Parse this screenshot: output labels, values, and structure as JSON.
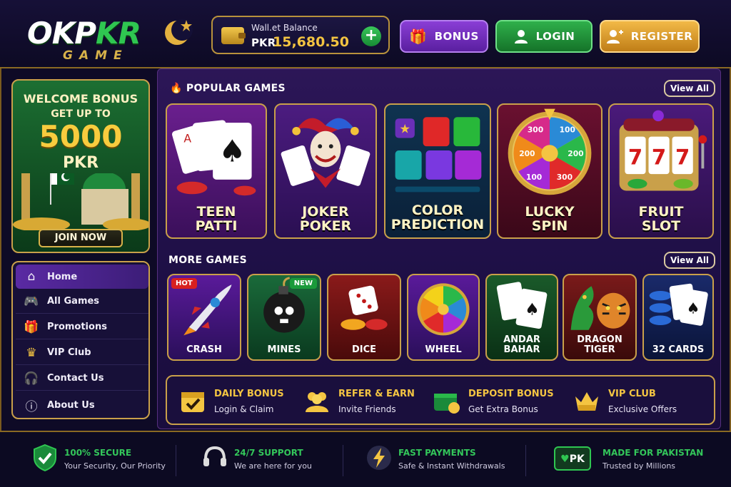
{
  "header": {
    "logo_main_1": "OKP",
    "logo_main_2": "KR",
    "logo_sub": "GAME",
    "wallet": {
      "label": "Wall.et Balance",
      "currency": "PKR",
      "amount": "15,680.50",
      "add_label": "+"
    },
    "buttons": {
      "bonus": "BONUS",
      "login": "LOGIN",
      "register": "REGISTER"
    }
  },
  "promo": {
    "line1": "WELCOME BONUS",
    "line2": "GET UP TO",
    "amount": "5000",
    "currency": "PKR",
    "join_label": "JOIN NOW"
  },
  "sidebar": {
    "items": [
      {
        "label": "Home",
        "icon": "home-icon",
        "glyph": "⌂"
      },
      {
        "label": "All Games",
        "icon": "gamepad-icon",
        "glyph": "🎮"
      },
      {
        "label": "Promotions",
        "icon": "gift-icon",
        "glyph": "🎁"
      },
      {
        "label": "VIP Club",
        "icon": "vip-crown-icon",
        "glyph": "♛"
      },
      {
        "label": "Contact Us",
        "icon": "headset-icon",
        "glyph": "🎧"
      },
      {
        "label": "About Us",
        "icon": "info-icon",
        "glyph": "ⓘ"
      }
    ]
  },
  "popular": {
    "title": "POPULAR GAMES",
    "view_all": "View All",
    "games": [
      {
        "line1": "TEEN",
        "line2": "PATTI"
      },
      {
        "line1": "JOKER",
        "line2": "POKER"
      },
      {
        "line1": "COLOR",
        "line2": "PREDICTION"
      },
      {
        "line1": "LUCKY",
        "line2": "SPIN"
      },
      {
        "line1": "FRUIT",
        "line2": "SLOT"
      }
    ],
    "wheel_values": [
      "100",
      "200",
      "300",
      "100",
      "200",
      "300"
    ],
    "slot_digits": [
      "7",
      "7",
      "7"
    ]
  },
  "more": {
    "title": "MORE GAMES",
    "view_all": "View All",
    "games": [
      {
        "line1": "CRASH",
        "line2": "",
        "tag": "HOT"
      },
      {
        "line1": "MINES",
        "line2": "",
        "tag": "NEW"
      },
      {
        "line1": "DICE",
        "line2": "",
        "tag": ""
      },
      {
        "line1": "WHEEL",
        "line2": "",
        "tag": ""
      },
      {
        "line1": "ANDAR BAHAR",
        "line2": "",
        "tag": ""
      },
      {
        "line1": "DRAGON",
        "line2": "TIGER",
        "tag": ""
      },
      {
        "line1": "32 CARDS",
        "line2": "",
        "tag": ""
      }
    ]
  },
  "features": [
    {
      "title": "DAILY BONUS",
      "subtitle": "Login & Claim",
      "icon": "calendar-check-icon"
    },
    {
      "title": "REFER & EARN",
      "subtitle": "Invite Friends",
      "icon": "users-icon"
    },
    {
      "title": "DEPOSIT BONUS",
      "subtitle": "Get Extra Bonus",
      "icon": "wallet-coin-icon"
    },
    {
      "title": "VIP CLUB",
      "subtitle": "Exclusive Offers",
      "icon": "vip-crown-icon"
    }
  ],
  "footer": [
    {
      "title": "100% SECURE",
      "subtitle": "Your Security, Our Priority",
      "icon": "shield-check-icon"
    },
    {
      "title": "24/7 SUPPORT",
      "subtitle": "We are here for you",
      "icon": "headset-icon"
    },
    {
      "title": "FAST PAYMENTS",
      "subtitle": "Safe & Instant Withdrawals",
      "icon": "lightning-icon"
    },
    {
      "title": "MADE FOR PAKISTAN",
      "subtitle": "Trusted by Millions",
      "icon": "pk-badge-icon",
      "badge": "PK"
    }
  ],
  "colors": {
    "gold": "#c9a04a",
    "green": "#2fc651",
    "purple": "#5a2aa3",
    "accent_gold": "#f4c542"
  }
}
